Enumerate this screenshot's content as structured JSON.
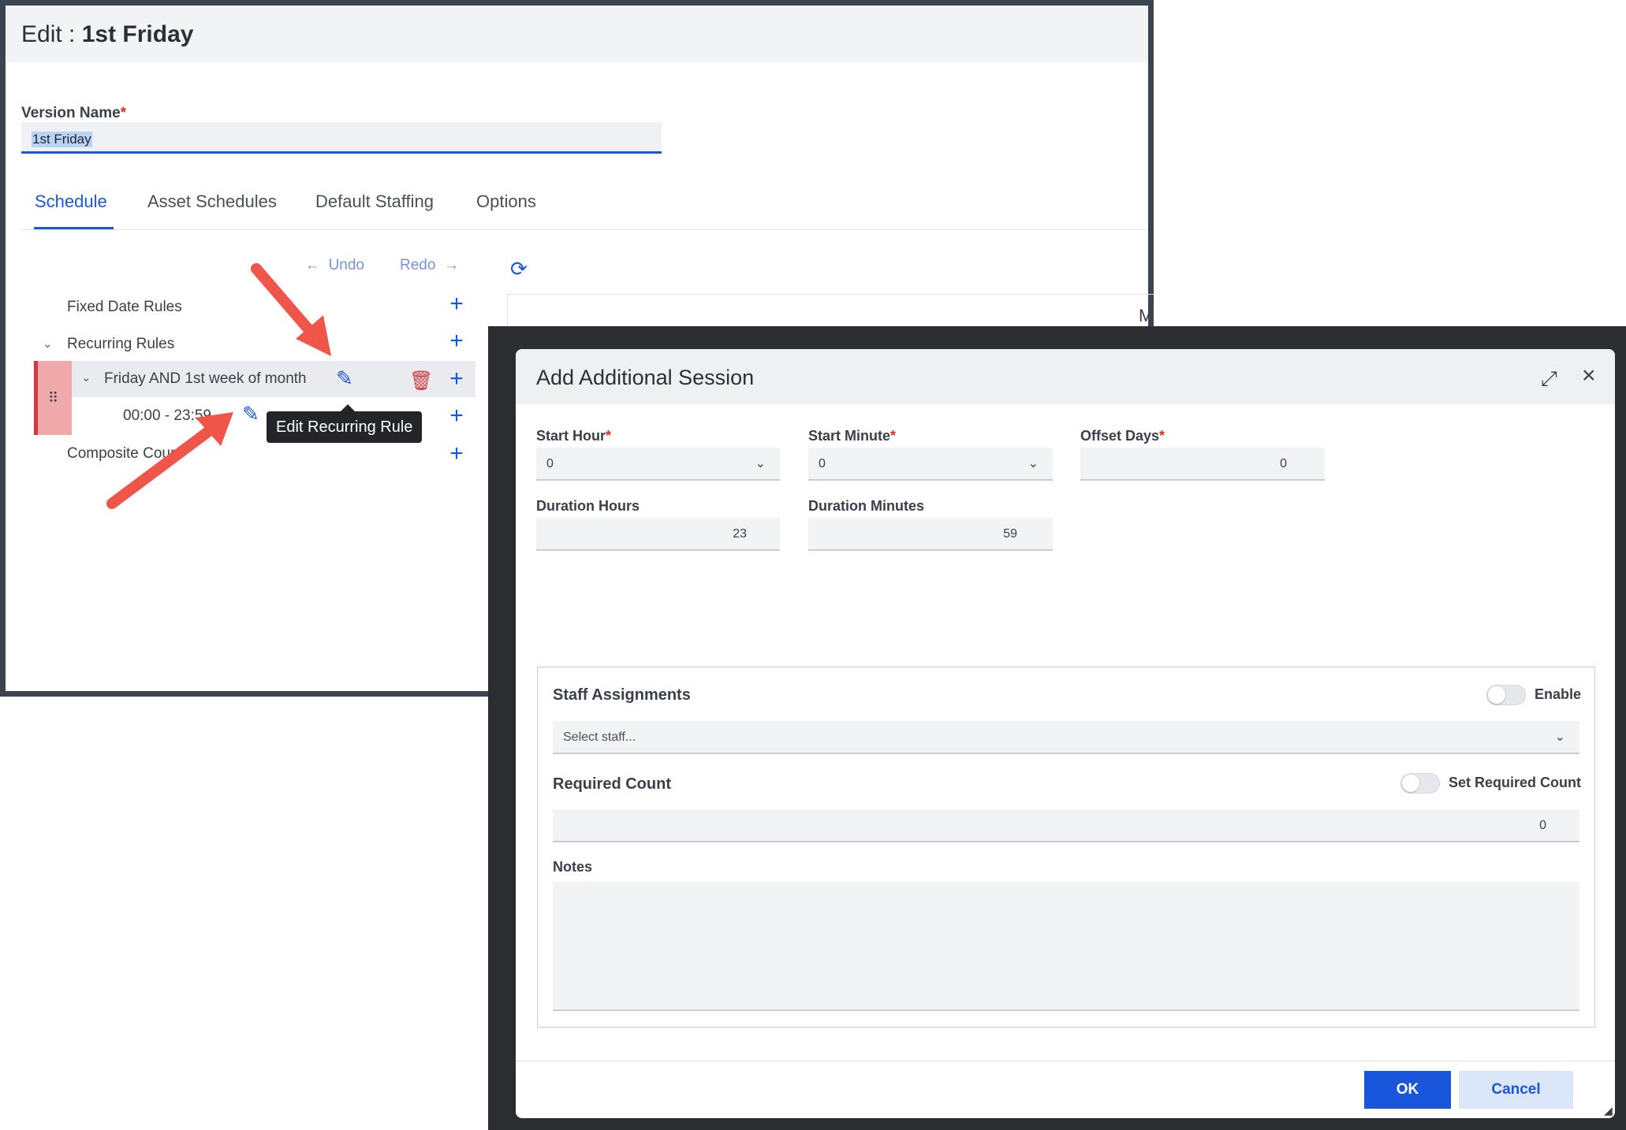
{
  "edit_window": {
    "title_prefix": "Edit :",
    "title_name": "1st Friday",
    "version_name_label": "Version Name",
    "required_mark": "*",
    "version_name_value": "1st Friday",
    "tabs": [
      {
        "label": "Schedule",
        "active": true
      },
      {
        "label": "Asset Schedules",
        "active": false
      },
      {
        "label": "Default Staffing",
        "active": false
      },
      {
        "label": "Options",
        "active": false
      }
    ],
    "undo_label": "Undo",
    "redo_label": "Redo",
    "tree": {
      "fixed_date_rules": "Fixed Date Rules",
      "recurring_rules": "Recurring Rules",
      "rule_friday": "Friday AND 1st week of month",
      "session_time": "00:00 - 23:59",
      "composite_courses": "Composite Cours"
    },
    "tooltip": "Edit Recurring Rule",
    "right_panel_text": "M",
    "accent_color": "#1a56db",
    "danger_color": "#d8373a",
    "arrow_color": "#f0554a"
  },
  "dialog": {
    "title": "Add Additional Session",
    "start_hour_label": "Start Hour",
    "start_hour_value": "0",
    "start_minute_label": "Start Minute",
    "start_minute_value": "0",
    "offset_days_label": "Offset Days",
    "offset_days_value": "0",
    "duration_hours_label": "Duration Hours",
    "duration_hours_value": "23",
    "duration_minutes_label": "Duration Minutes",
    "duration_minutes_value": "59",
    "staff_assignments_label": "Staff Assignments",
    "enable_label": "Enable",
    "select_staff_placeholder": "Select staff...",
    "required_count_label": "Required Count",
    "set_required_count_label": "Set Required Count",
    "required_count_value": "0",
    "notes_label": "Notes",
    "ok_label": "OK",
    "cancel_label": "Cancel"
  }
}
